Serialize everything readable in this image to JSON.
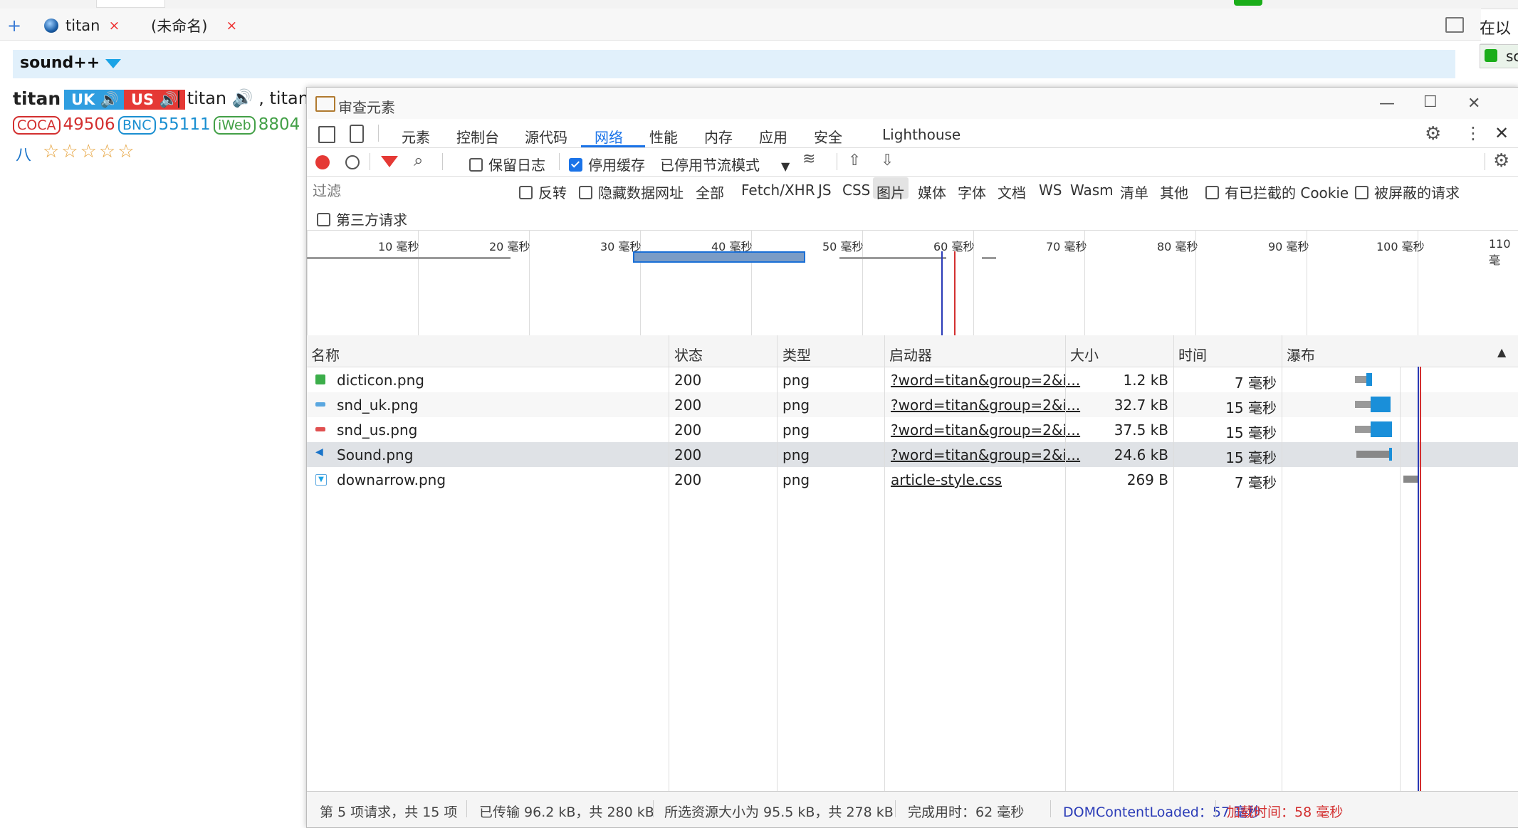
{
  "browser": {
    "tabs": [
      {
        "label": "titan",
        "close": "×"
      },
      {
        "label": "(未命名)",
        "close": "×"
      }
    ],
    "new_tab": "+",
    "right_pane_title": "在以下",
    "right_pane_tile": "sc"
  },
  "dictionary": {
    "name": "sound++",
    "headword": "titan",
    "uk_label": "UK",
    "us_label": "US",
    "forms": "| titan 🔊 , titans",
    "freq": [
      {
        "label": "COCA",
        "value": "49506"
      },
      {
        "label": "BNC",
        "value": "55111"
      },
      {
        "label": "iWeb",
        "value": "8804"
      }
    ],
    "ba": "八",
    "stars": "☆☆☆☆☆"
  },
  "devtools": {
    "title": "审查元素",
    "tabs": [
      "元素",
      "控制台",
      "源代码",
      "网络",
      "性能",
      "内存",
      "应用",
      "安全",
      "Lighthouse"
    ],
    "active_tab": "网络",
    "toolbar": {
      "preserve_log": "保留日志",
      "disable_cache": "停用缓存",
      "throttle": "已停用节流模式"
    },
    "filter": {
      "placeholder": "过滤",
      "invert": "反转",
      "hide_data_urls": "隐藏数据网址",
      "types": [
        "全部",
        "Fetch/XHR",
        "JS",
        "CSS",
        "图片",
        "媒体",
        "字体",
        "文档",
        "WS",
        "Wasm",
        "清单",
        "其他"
      ],
      "active_type": "图片",
      "blocked_cookies": "有已拦截的 Cookie",
      "blocked_requests": "被屏蔽的请求",
      "third_party": "第三方请求"
    },
    "overview_ticks": [
      "10 毫秒",
      "20 毫秒",
      "30 毫秒",
      "40 毫秒",
      "50 毫秒",
      "60 毫秒",
      "70 毫秒",
      "80 毫秒",
      "90 毫秒",
      "100 毫秒",
      "110 毫"
    ],
    "columns": [
      "名称",
      "状态",
      "类型",
      "启动器",
      "大小",
      "时间",
      "瀑布"
    ],
    "rows": [
      {
        "name": "dicticon.png",
        "status": "200",
        "type": "png",
        "initiator": "?word=titan&group=2&i...",
        "size": "1.2 kB",
        "time": "7 毫秒"
      },
      {
        "name": "snd_uk.png",
        "status": "200",
        "type": "png",
        "initiator": "?word=titan&group=2&i...",
        "size": "32.7 kB",
        "time": "15 毫秒"
      },
      {
        "name": "snd_us.png",
        "status": "200",
        "type": "png",
        "initiator": "?word=titan&group=2&i...",
        "size": "37.5 kB",
        "time": "15 毫秒"
      },
      {
        "name": "Sound.png",
        "status": "200",
        "type": "png",
        "initiator": "?word=titan&group=2&i...",
        "size": "24.6 kB",
        "time": "15 毫秒"
      },
      {
        "name": "downarrow.png",
        "status": "200",
        "type": "png",
        "initiator": "article-style.css",
        "size": "269 B",
        "time": "7 毫秒"
      }
    ],
    "status": {
      "requests": "第 5 项请求，共 15 项",
      "transferred": "已传输 96.2 kB，共 280 kB",
      "resources": "所选资源大小为 95.5 kB，共 278 kB",
      "finish": "完成用时：62 毫秒",
      "dcl": "DOMContentLoaded：57 毫秒",
      "load": "加载时间：58 毫秒"
    },
    "colors": {
      "dcl": "#2a3bb7",
      "load": "#d32f2f",
      "accent": "#1a73e8"
    }
  }
}
